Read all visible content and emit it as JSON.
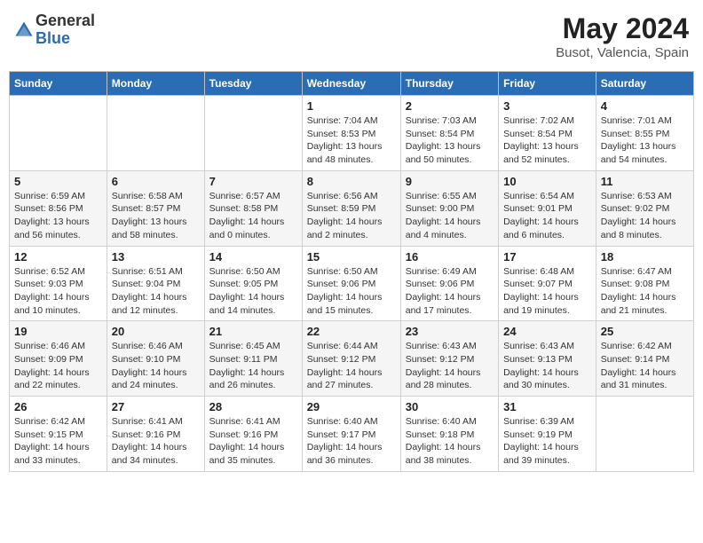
{
  "header": {
    "logo_general": "General",
    "logo_blue": "Blue",
    "month_title": "May 2024",
    "location": "Busot, Valencia, Spain"
  },
  "days_of_week": [
    "Sunday",
    "Monday",
    "Tuesday",
    "Wednesday",
    "Thursday",
    "Friday",
    "Saturday"
  ],
  "weeks": [
    [
      {
        "day": "",
        "info": ""
      },
      {
        "day": "",
        "info": ""
      },
      {
        "day": "",
        "info": ""
      },
      {
        "day": "1",
        "info": "Sunrise: 7:04 AM\nSunset: 8:53 PM\nDaylight: 13 hours\nand 48 minutes."
      },
      {
        "day": "2",
        "info": "Sunrise: 7:03 AM\nSunset: 8:54 PM\nDaylight: 13 hours\nand 50 minutes."
      },
      {
        "day": "3",
        "info": "Sunrise: 7:02 AM\nSunset: 8:54 PM\nDaylight: 13 hours\nand 52 minutes."
      },
      {
        "day": "4",
        "info": "Sunrise: 7:01 AM\nSunset: 8:55 PM\nDaylight: 13 hours\nand 54 minutes."
      }
    ],
    [
      {
        "day": "5",
        "info": "Sunrise: 6:59 AM\nSunset: 8:56 PM\nDaylight: 13 hours\nand 56 minutes."
      },
      {
        "day": "6",
        "info": "Sunrise: 6:58 AM\nSunset: 8:57 PM\nDaylight: 13 hours\nand 58 minutes."
      },
      {
        "day": "7",
        "info": "Sunrise: 6:57 AM\nSunset: 8:58 PM\nDaylight: 14 hours\nand 0 minutes."
      },
      {
        "day": "8",
        "info": "Sunrise: 6:56 AM\nSunset: 8:59 PM\nDaylight: 14 hours\nand 2 minutes."
      },
      {
        "day": "9",
        "info": "Sunrise: 6:55 AM\nSunset: 9:00 PM\nDaylight: 14 hours\nand 4 minutes."
      },
      {
        "day": "10",
        "info": "Sunrise: 6:54 AM\nSunset: 9:01 PM\nDaylight: 14 hours\nand 6 minutes."
      },
      {
        "day": "11",
        "info": "Sunrise: 6:53 AM\nSunset: 9:02 PM\nDaylight: 14 hours\nand 8 minutes."
      }
    ],
    [
      {
        "day": "12",
        "info": "Sunrise: 6:52 AM\nSunset: 9:03 PM\nDaylight: 14 hours\nand 10 minutes."
      },
      {
        "day": "13",
        "info": "Sunrise: 6:51 AM\nSunset: 9:04 PM\nDaylight: 14 hours\nand 12 minutes."
      },
      {
        "day": "14",
        "info": "Sunrise: 6:50 AM\nSunset: 9:05 PM\nDaylight: 14 hours\nand 14 minutes."
      },
      {
        "day": "15",
        "info": "Sunrise: 6:50 AM\nSunset: 9:06 PM\nDaylight: 14 hours\nand 15 minutes."
      },
      {
        "day": "16",
        "info": "Sunrise: 6:49 AM\nSunset: 9:06 PM\nDaylight: 14 hours\nand 17 minutes."
      },
      {
        "day": "17",
        "info": "Sunrise: 6:48 AM\nSunset: 9:07 PM\nDaylight: 14 hours\nand 19 minutes."
      },
      {
        "day": "18",
        "info": "Sunrise: 6:47 AM\nSunset: 9:08 PM\nDaylight: 14 hours\nand 21 minutes."
      }
    ],
    [
      {
        "day": "19",
        "info": "Sunrise: 6:46 AM\nSunset: 9:09 PM\nDaylight: 14 hours\nand 22 minutes."
      },
      {
        "day": "20",
        "info": "Sunrise: 6:46 AM\nSunset: 9:10 PM\nDaylight: 14 hours\nand 24 minutes."
      },
      {
        "day": "21",
        "info": "Sunrise: 6:45 AM\nSunset: 9:11 PM\nDaylight: 14 hours\nand 26 minutes."
      },
      {
        "day": "22",
        "info": "Sunrise: 6:44 AM\nSunset: 9:12 PM\nDaylight: 14 hours\nand 27 minutes."
      },
      {
        "day": "23",
        "info": "Sunrise: 6:43 AM\nSunset: 9:12 PM\nDaylight: 14 hours\nand 28 minutes."
      },
      {
        "day": "24",
        "info": "Sunrise: 6:43 AM\nSunset: 9:13 PM\nDaylight: 14 hours\nand 30 minutes."
      },
      {
        "day": "25",
        "info": "Sunrise: 6:42 AM\nSunset: 9:14 PM\nDaylight: 14 hours\nand 31 minutes."
      }
    ],
    [
      {
        "day": "26",
        "info": "Sunrise: 6:42 AM\nSunset: 9:15 PM\nDaylight: 14 hours\nand 33 minutes."
      },
      {
        "day": "27",
        "info": "Sunrise: 6:41 AM\nSunset: 9:16 PM\nDaylight: 14 hours\nand 34 minutes."
      },
      {
        "day": "28",
        "info": "Sunrise: 6:41 AM\nSunset: 9:16 PM\nDaylight: 14 hours\nand 35 minutes."
      },
      {
        "day": "29",
        "info": "Sunrise: 6:40 AM\nSunset: 9:17 PM\nDaylight: 14 hours\nand 36 minutes."
      },
      {
        "day": "30",
        "info": "Sunrise: 6:40 AM\nSunset: 9:18 PM\nDaylight: 14 hours\nand 38 minutes."
      },
      {
        "day": "31",
        "info": "Sunrise: 6:39 AM\nSunset: 9:19 PM\nDaylight: 14 hours\nand 39 minutes."
      },
      {
        "day": "",
        "info": ""
      }
    ]
  ]
}
